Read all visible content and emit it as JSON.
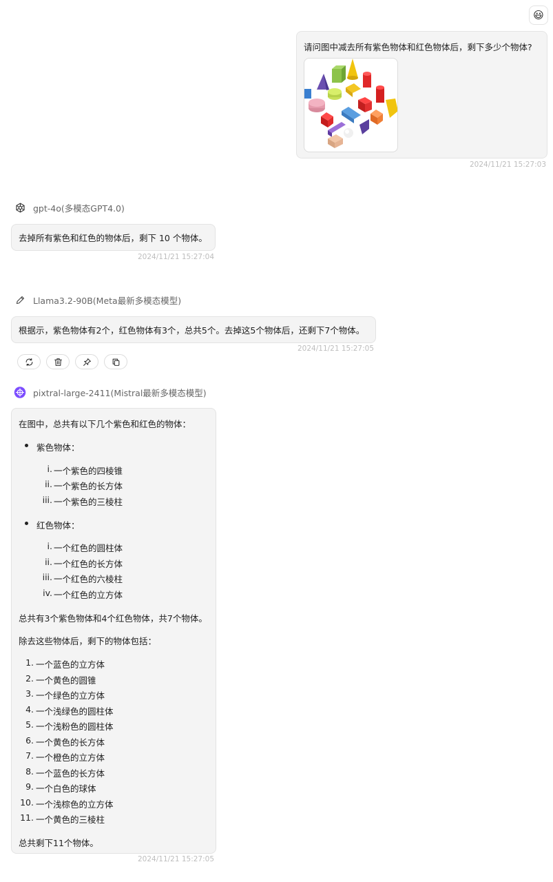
{
  "user": {
    "avatar": "smile-emoji",
    "avatar_glyph": "😃",
    "message": "请问图中减去所有紫色物体和红色物体后，剩下多少个物体?",
    "timestamp": "2024/11/21 15:27:03"
  },
  "responses": [
    {
      "model": "gpt-4o(多模态GPT4.0)",
      "icon": "openai-icon",
      "text": "去掉所有紫色和红色的物体后，剩下 10 个物体。",
      "timestamp": "2024/11/21 15:27:04"
    },
    {
      "model": "Llama3.2-90B(Meta最新多模态模型)",
      "icon": "pencil-icon",
      "text": "根据示，紫色物体有2个，红色物体有3个，总共5个。去掉这5个物体后，还剩下7个物体。",
      "timestamp": "2024/11/21 15:27:05",
      "actions": [
        "refresh-icon",
        "trash-icon",
        "pin-icon",
        "copy-icon"
      ]
    },
    {
      "model": "pixtral-large-2411(Mistral最新多模态模型)",
      "icon": "mistral-icon",
      "intro": "在图中，总共有以下几个紫色和红色的物体：",
      "purple_heading": "紫色物体：",
      "purple_items": [
        "一个紫色的四棱锥",
        "一个紫色的长方体",
        "一个紫色的三棱柱"
      ],
      "red_heading": "红色物体：",
      "red_items": [
        "一个红色的圆柱体",
        "一个红色的长方体",
        "一个红色的六棱柱",
        "一个红色的立方体"
      ],
      "roman": [
        "i.",
        "ii.",
        "iii.",
        "iv."
      ],
      "summary1": "总共有3个紫色物体和4个红色物体，共7个物体。",
      "summary2": "除去这些物体后，剩下的物体包括：",
      "remaining": [
        "一个蓝色的立方体",
        "一个黄色的圆锥",
        "一个绿色的立方体",
        "一个浅绿色的圆柱体",
        "一个浅粉色的圆柱体",
        "一个黄色的长方体",
        "一个橙色的立方体",
        "一个蓝色的长方体",
        "一个白色的球体",
        "一个浅棕色的立方体",
        "一个黄色的三棱柱"
      ],
      "remaining_nums": [
        "1.",
        "2.",
        "3.",
        "4.",
        "5.",
        "6.",
        "7.",
        "8.",
        "9.",
        "10.",
        "11."
      ],
      "final": "总共剩下11个物体。",
      "timestamp": "2024/11/21 15:27:05"
    }
  ],
  "colors": {
    "bubble_bg": "#f4f4f4",
    "border": "#e3e3e3",
    "timestamp": "#bdbdbd",
    "mistral_accent": "#7c4dff"
  }
}
